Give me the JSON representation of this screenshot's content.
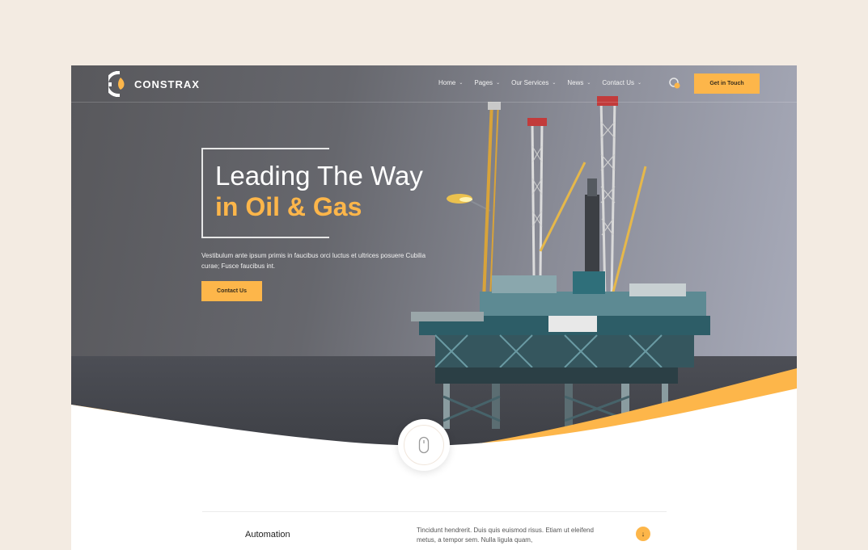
{
  "brand": {
    "name": "CONSTRAX",
    "accent": "#fdb64a"
  },
  "nav": {
    "items": [
      {
        "label": "Home"
      },
      {
        "label": "Pages"
      },
      {
        "label": "Our Services"
      },
      {
        "label": "News"
      },
      {
        "label": "Contact Us"
      }
    ],
    "caret": "⌄",
    "cart_icon": "cart-icon",
    "cta_label": "Get in Touch"
  },
  "hero": {
    "title_line1": "Leading The Way",
    "title_line2": "in Oil & Gas",
    "description": "Vestibulum ante ipsum primis in faucibus orci luctus et ultrices posuere Cubilia curae; Fusce faucibus int.",
    "button_label": "Contact Us",
    "background_image": "offshore-oil-rig"
  },
  "scroll_indicator": {
    "icon": "mouse-icon"
  },
  "feature": {
    "title": "Automation",
    "description": "Tincidunt hendrerit. Duis quis euismod risus. Etiam ut eleifend metus, a tempor sem. Nulla ligula quam,",
    "arrow_icon": "arrow-down-icon"
  }
}
